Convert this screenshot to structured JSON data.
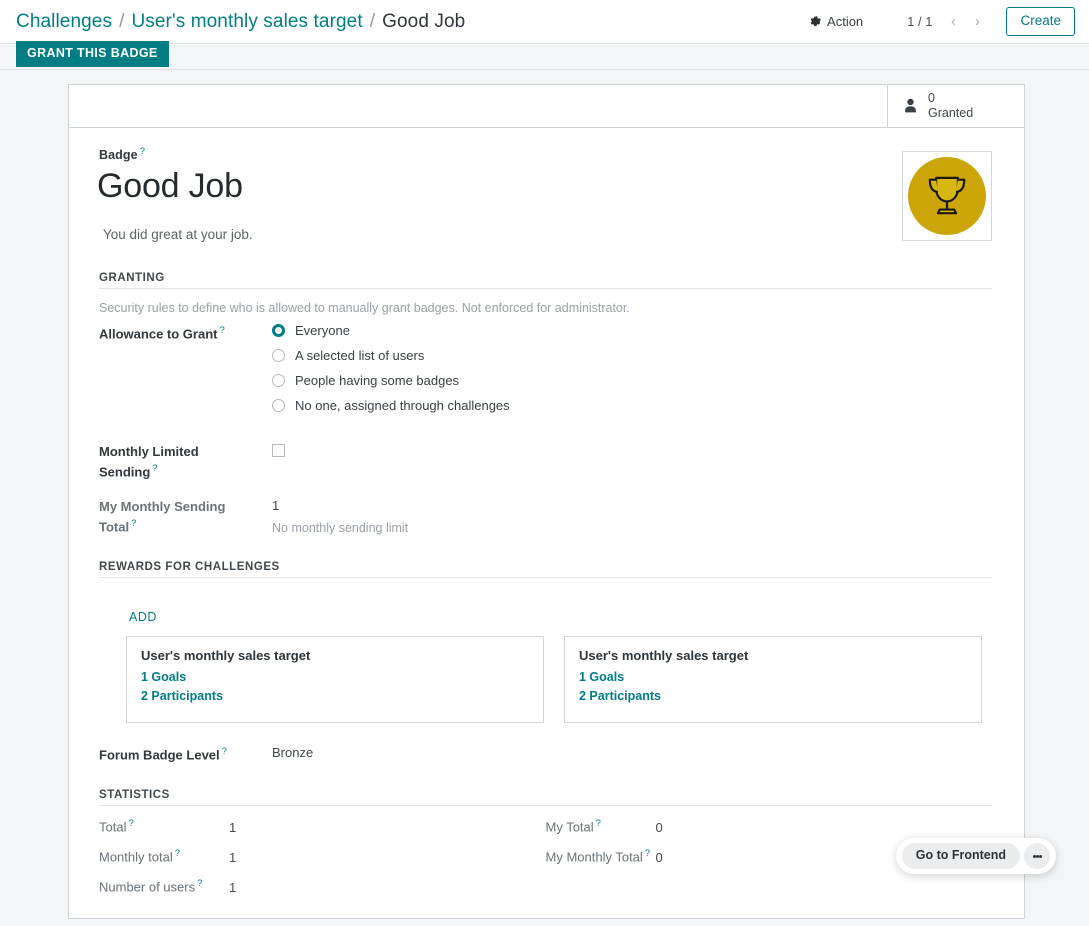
{
  "breadcrumb": {
    "root": "Challenges",
    "parent": "User's monthly sales target",
    "current": "Good Job",
    "separator": "/"
  },
  "controlpanel": {
    "action_label": "Action",
    "gear_icon": "gear-icon",
    "pager": "1 / 1",
    "prev_icon": "‹",
    "next_icon": "›",
    "create_label": "Create"
  },
  "statusbar": {
    "grant_label": "GRANT THIS BADGE"
  },
  "statbutton": {
    "icon": "person-icon",
    "count": "0",
    "label": "Granted"
  },
  "badge": {
    "field_label": "Badge",
    "tip": "?",
    "title": "Good Job",
    "description": "You did great at your job.",
    "image_icon": "trophy-icon"
  },
  "granting": {
    "group_title": "GRANTING",
    "helper": "Security rules to define who is allowed to manually grant badges. Not enforced for administrator.",
    "allowance_label": "Allowance to Grant",
    "options": [
      {
        "label": "Everyone",
        "checked": true
      },
      {
        "label": "A selected list of users",
        "checked": false
      },
      {
        "label": "People having some badges",
        "checked": false
      },
      {
        "label": "No one, assigned through challenges",
        "checked": false
      }
    ],
    "monthly_limited_label_line1": "Monthly Limited",
    "monthly_limited_label_line2": "Sending",
    "monthly_limited_checked": false,
    "my_monthly_label_line1": "My Monthly Sending",
    "my_monthly_label_line2": "Total",
    "my_monthly_value": "1",
    "no_limit_text": "No monthly sending limit"
  },
  "rewards": {
    "group_title": "REWARDS FOR CHALLENGES",
    "add_label": "ADD",
    "cards": [
      {
        "title": "User's monthly sales target",
        "goals": "1 Goals",
        "participants": "2 Participants"
      },
      {
        "title": "User's monthly sales target",
        "goals": "1 Goals",
        "participants": "2 Participants"
      }
    ],
    "forum_level_label": "Forum Badge Level",
    "forum_level_value": "Bronze"
  },
  "statistics": {
    "group_title": "STATISTICS",
    "left": [
      {
        "label": "Total",
        "value": "1"
      },
      {
        "label": "Monthly total",
        "value": "1"
      },
      {
        "label": "Number of users",
        "value": "1"
      }
    ],
    "right": [
      {
        "label": "My Total",
        "value": "0"
      },
      {
        "label": "My Monthly Total",
        "value": "0"
      }
    ]
  },
  "frontend": {
    "label": "Go to Frontend",
    "menu_icon": "vertical-dots-icon"
  },
  "colors": {
    "accent": "#017e84",
    "badge_gold": "#cca508",
    "page_bg": "#f4f5f7",
    "border": "#ced4da"
  }
}
